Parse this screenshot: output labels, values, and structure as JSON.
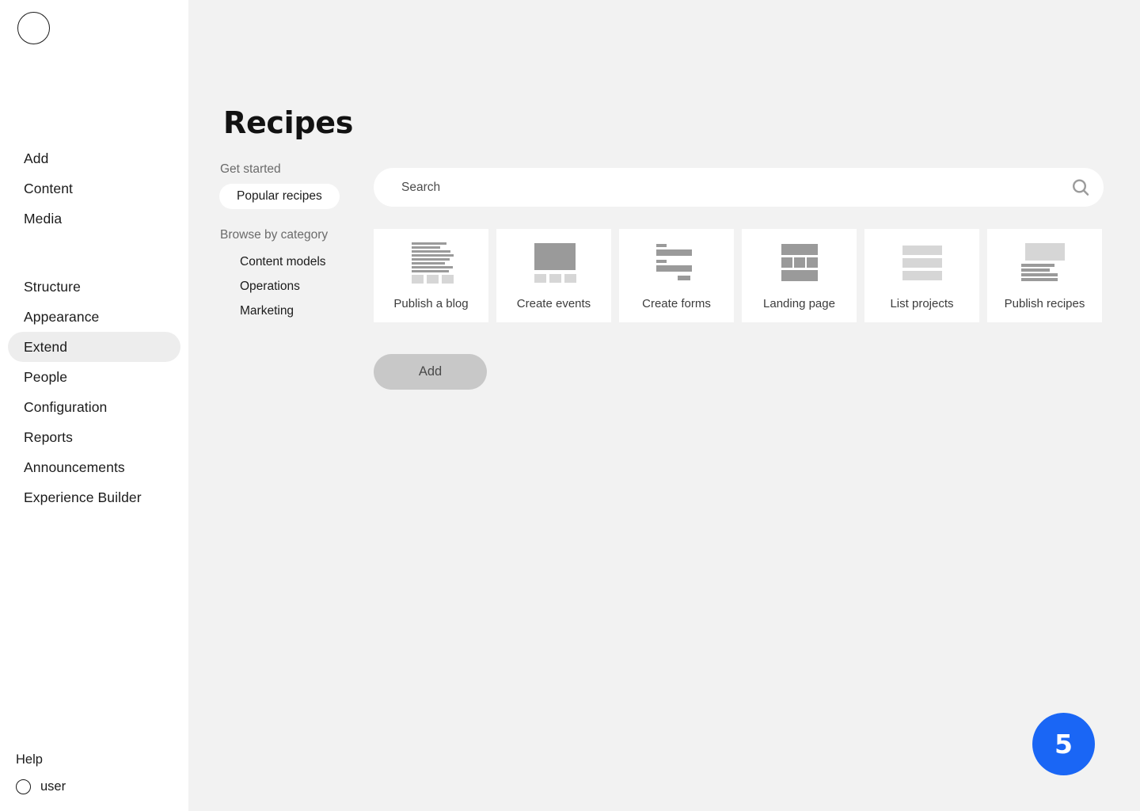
{
  "sidebar": {
    "logo_icon": "circle-logo-icon",
    "primary_items": [
      {
        "label": "Add"
      },
      {
        "label": "Content"
      },
      {
        "label": "Media"
      }
    ],
    "secondary_items": [
      {
        "label": "Structure"
      },
      {
        "label": "Appearance"
      },
      {
        "label": "Extend"
      },
      {
        "label": "People"
      },
      {
        "label": "Configuration"
      },
      {
        "label": "Reports"
      },
      {
        "label": "Announcements"
      },
      {
        "label": "Experience Builder"
      }
    ],
    "active_item": "Extend",
    "help_label": "Help",
    "user_label": "user",
    "user_avatar_icon": "user-avatar-icon"
  },
  "main": {
    "page_title": "Recipes",
    "facets": {
      "get_started_heading": "Get started",
      "get_started_items": [
        {
          "label": "Popular recipes",
          "selected": true
        }
      ],
      "browse_heading": "Browse by category",
      "browse_items": [
        {
          "label": "Content models"
        },
        {
          "label": "Operations"
        },
        {
          "label": "Marketing"
        }
      ]
    },
    "search": {
      "placeholder": "Search",
      "value": "",
      "icon": "search-icon"
    },
    "cards": [
      {
        "label": "Publish a blog",
        "art": "lines-with-tiles"
      },
      {
        "label": "Create events",
        "art": "block-with-tiles"
      },
      {
        "label": "Create forms",
        "art": "form-fields"
      },
      {
        "label": "Landing page",
        "art": "page-sections"
      },
      {
        "label": "List projects",
        "art": "three-rows"
      },
      {
        "label": "Publish recipes",
        "art": "image-with-lines"
      }
    ],
    "add_button_label": "Add",
    "badge": {
      "count": "5",
      "color": "#1a66f5"
    }
  }
}
